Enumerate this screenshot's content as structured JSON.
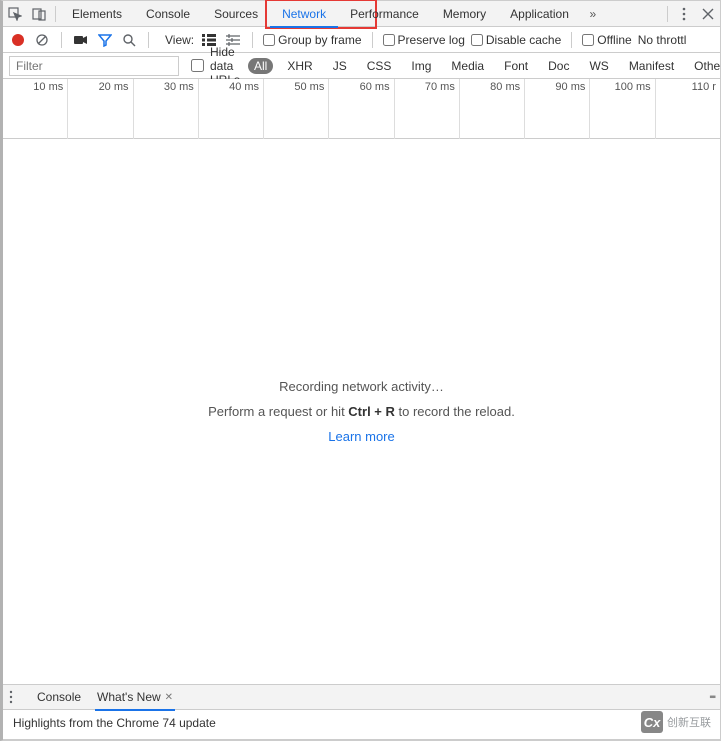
{
  "tabs": {
    "items": [
      "Elements",
      "Console",
      "Sources",
      "Network",
      "Performance",
      "Memory",
      "Application"
    ],
    "activeIndex": 3,
    "overflow": "»"
  },
  "toolbar": {
    "view_label": "View:",
    "group_by_frame": "Group by frame",
    "preserve_log": "Preserve log",
    "disable_cache": "Disable cache",
    "offline": "Offline",
    "throttling": "No throttl"
  },
  "filter": {
    "placeholder": "Filter",
    "hide_data_urls": "Hide data URLs",
    "types": [
      "All",
      "XHR",
      "JS",
      "CSS",
      "Img",
      "Media",
      "Font",
      "Doc",
      "WS",
      "Manifest",
      "Other"
    ],
    "activeType": "All"
  },
  "timeline": {
    "ticks": [
      "10 ms",
      "20 ms",
      "30 ms",
      "40 ms",
      "50 ms",
      "60 ms",
      "70 ms",
      "80 ms",
      "90 ms",
      "100 ms",
      "110 r"
    ]
  },
  "empty": {
    "recording": "Recording network activity…",
    "hint_before": "Perform a request or hit ",
    "hint_key": "Ctrl + R",
    "hint_after": " to record the reload.",
    "learn_more": "Learn more"
  },
  "drawer": {
    "tabs": [
      "Console",
      "What's New"
    ],
    "activeIndex": 1,
    "body": "Highlights from the Chrome 74 update"
  },
  "watermark": {
    "brand": "创新互联",
    "logo": "Cx"
  }
}
